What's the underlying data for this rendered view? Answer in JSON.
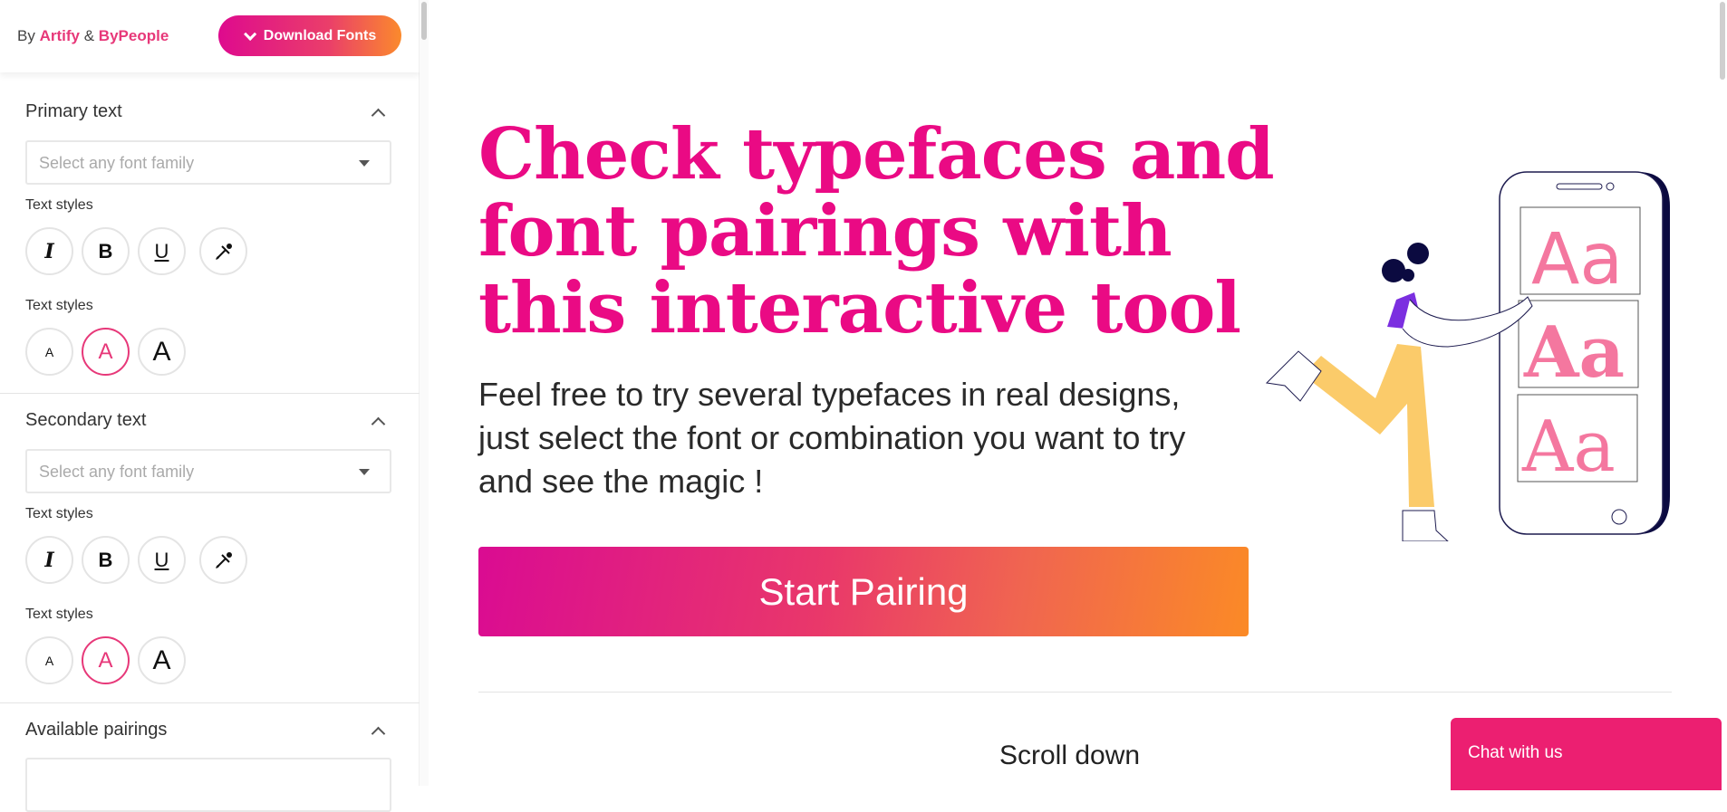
{
  "sidebar": {
    "credit_prefix": "By",
    "credit_brand1": "Artify",
    "credit_amp": "&",
    "credit_brand2": "ByPeople",
    "download_label": "Download Fonts",
    "sections": [
      {
        "title": "Primary text",
        "select_placeholder": "Select any font family",
        "styles_label": "Text styles",
        "style_buttons": [
          "italic",
          "bold",
          "underline",
          "color-picker"
        ],
        "size_label": "Text styles",
        "size_buttons": [
          {
            "label": "A",
            "size": "small"
          },
          {
            "label": "A",
            "size": "medium",
            "selected": true
          },
          {
            "label": "A",
            "size": "large"
          }
        ]
      },
      {
        "title": "Secondary text",
        "select_placeholder": "Select any font family",
        "styles_label": "Text styles",
        "style_buttons": [
          "italic",
          "bold",
          "underline",
          "color-picker"
        ],
        "size_label": "Text styles",
        "size_buttons": [
          {
            "label": "A",
            "size": "small"
          },
          {
            "label": "A",
            "size": "medium",
            "selected": true
          },
          {
            "label": "A",
            "size": "large"
          }
        ]
      },
      {
        "title": "Available pairings"
      }
    ],
    "icon_labels": {
      "italic": "I",
      "bold": "B",
      "underline": "U"
    }
  },
  "main": {
    "headline": "Check typefaces and font pairings with this interactive tool",
    "lead": "Feel free to try several typefaces in real designs, just select the font or combination you want to try and see the magic !",
    "cta_label": "Start Pairing",
    "scroll_hint": "Scroll down",
    "illustration": {
      "sample_text": "Aa"
    }
  },
  "chat": {
    "label": "Chat with us"
  },
  "colors": {
    "accent": "#ea0a84",
    "brand": "#e73879",
    "chat": "#ec1f71",
    "gradient_start": "#de0a8e",
    "gradient_end": "#fb8a2c"
  }
}
